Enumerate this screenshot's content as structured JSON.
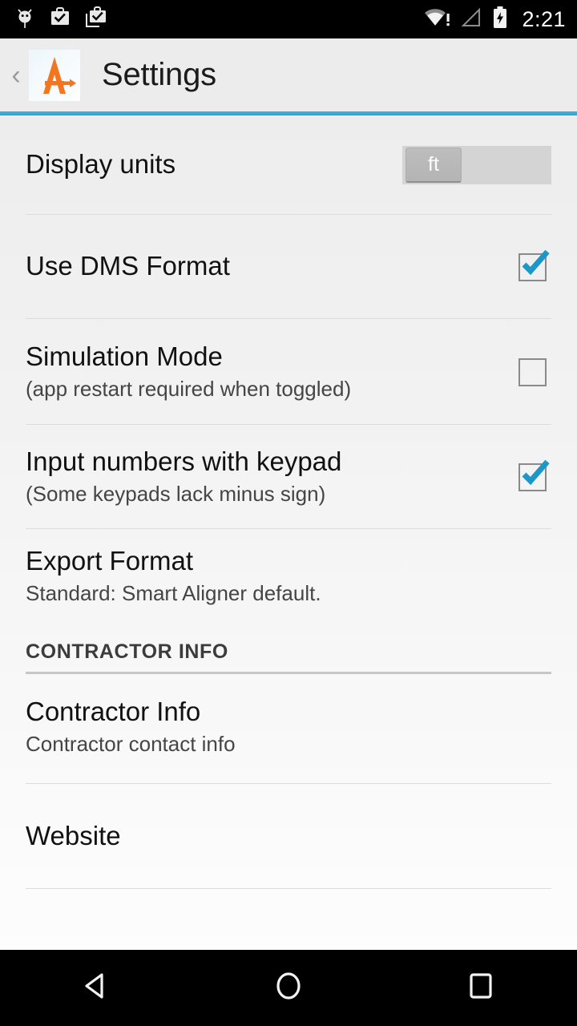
{
  "status_bar": {
    "icons": [
      "android-debug-icon",
      "work-briefcase-check-icon",
      "work-briefcase-copy-icon"
    ],
    "wifi": "wifi-warning-icon",
    "signal": "cell-signal-empty-icon",
    "battery": "battery-charging-icon",
    "clock": "2:21"
  },
  "action_bar": {
    "back": "‹",
    "logo": "smart-aligner-logo",
    "title": "Settings",
    "accent_color": "#37aedb"
  },
  "settings": {
    "display_units": {
      "title": "Display units",
      "value": "ft"
    },
    "dms_format": {
      "title": "Use DMS Format",
      "checked": true
    },
    "simulation_mode": {
      "title": "Simulation Mode",
      "subtitle": "(app restart required when toggled)",
      "checked": false
    },
    "keypad_input": {
      "title": "Input numbers with keypad",
      "subtitle": "(Some keypads lack minus sign)",
      "checked": true
    },
    "export_format": {
      "title": "Export Format",
      "subtitle": "Standard: Smart Aligner default."
    },
    "section_contractor": "CONTRACTOR INFO",
    "contractor_info": {
      "title": "Contractor Info",
      "subtitle": "Contractor contact info"
    },
    "website": {
      "title": "Website"
    }
  },
  "nav_bar": {
    "back": "nav-back-icon",
    "home": "nav-home-icon",
    "recents": "nav-recents-icon"
  }
}
